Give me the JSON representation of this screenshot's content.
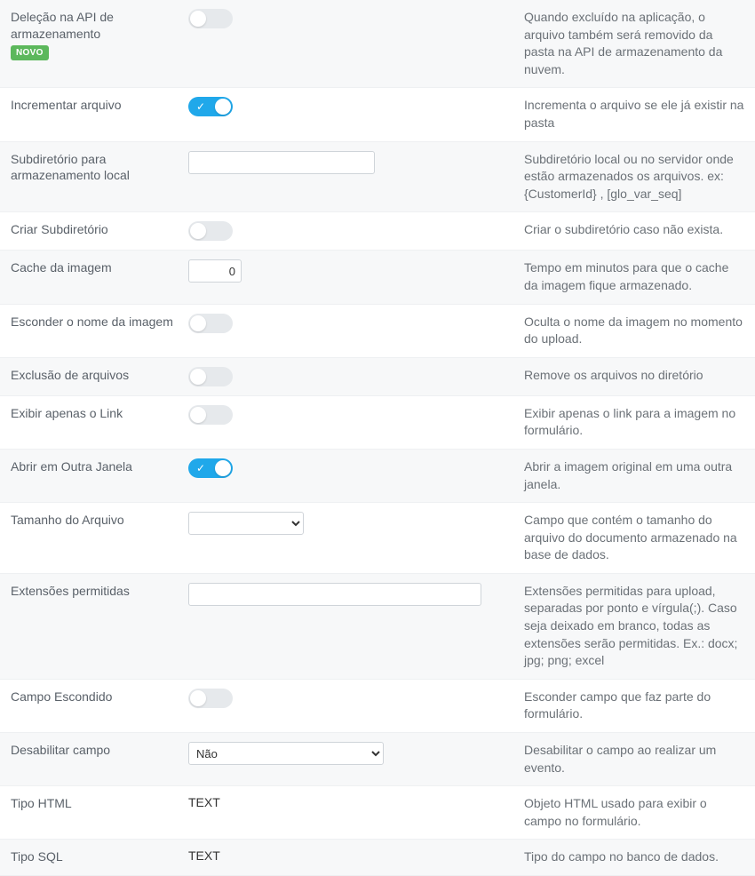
{
  "badges": {
    "new": "NOVO"
  },
  "rows": {
    "apiDelete": {
      "label": "Deleção na API de armazenamento",
      "toggle": false,
      "desc": "Quando excluído na aplicação, o arquivo também será removido da pasta na API de armazenamento da nuvem."
    },
    "increment": {
      "label": "Incrementar arquivo",
      "toggle": true,
      "desc": "Incrementa o arquivo se ele já existir na pasta"
    },
    "subdir": {
      "label": "Subdiretório para armazenamento local",
      "value": "",
      "desc": "Subdiretório local ou no servidor onde estão armazenados os arquivos. ex: {CustomerId} , [glo_var_seq]"
    },
    "createSubdir": {
      "label": "Criar Subdiretório",
      "toggle": false,
      "desc": "Criar o subdiretório caso não exista."
    },
    "imgCache": {
      "label": "Cache da imagem",
      "value": "0",
      "desc": "Tempo em minutos para que o cache da imagem fique armazenado."
    },
    "hideImgName": {
      "label": "Esconder o nome da imagem",
      "toggle": false,
      "desc": "Oculta o nome da imagem no momento do upload."
    },
    "deleteFiles": {
      "label": "Exclusão de arquivos",
      "toggle": false,
      "desc": "Remove os arquivos no diretório"
    },
    "showLinkOnly": {
      "label": "Exibir apenas o Link",
      "toggle": false,
      "desc": "Exibir apenas o link para a imagem no formulário."
    },
    "openNewWin": {
      "label": "Abrir em Outra Janela",
      "toggle": true,
      "desc": "Abrir a imagem original em uma outra janela."
    },
    "fileSize": {
      "label": "Tamanho do Arquivo",
      "selected": "",
      "desc": "Campo que contém o tamanho do arquivo do documento armazenado na base de dados."
    },
    "allowedExt": {
      "label": "Extensões permitidas",
      "value": "",
      "desc": "Extensões permitidas para upload, separadas por ponto e vírgula(;). Caso seja deixado em branco, todas as extensões serão permitidas. Ex.: docx; jpg; png; excel"
    },
    "hiddenField": {
      "label": "Campo Escondido",
      "toggle": false,
      "desc": "Esconder campo que faz parte do formulário."
    },
    "disableField": {
      "label": "Desabilitar campo",
      "selected": "Não",
      "desc": "Desabilitar o campo ao realizar um evento."
    },
    "htmlType": {
      "label": "Tipo HTML",
      "value": "TEXT",
      "desc": "Objeto HTML usado para exibir o campo no formulário."
    },
    "sqlType": {
      "label": "Tipo SQL",
      "value": "TEXT",
      "desc": "Tipo do campo no banco de dados."
    }
  }
}
